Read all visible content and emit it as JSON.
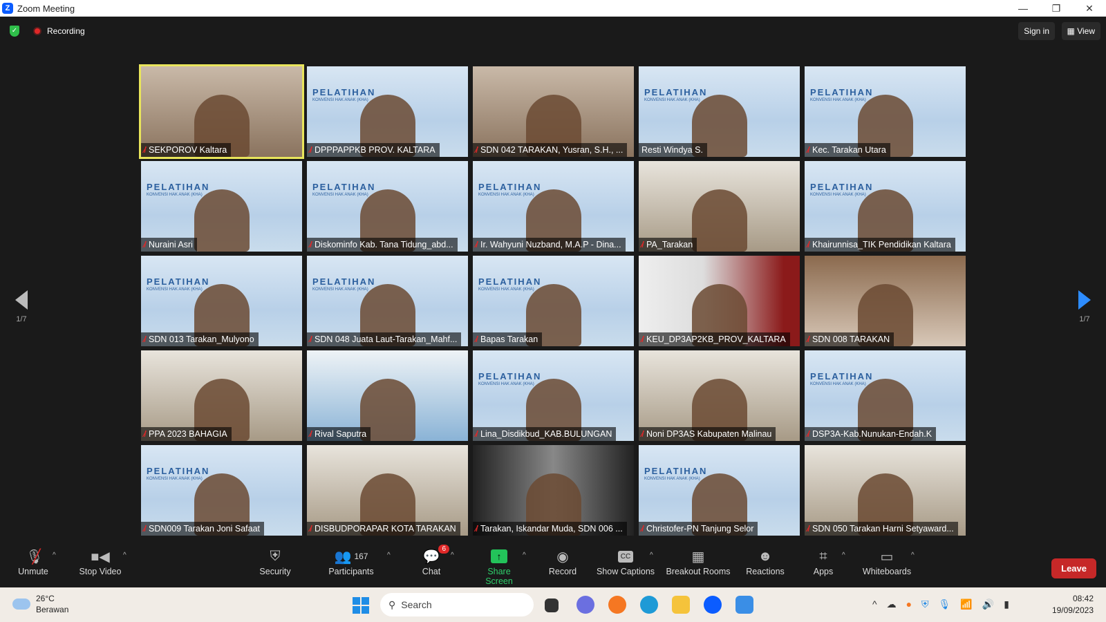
{
  "window": {
    "title": "Zoom Meeting",
    "controls": [
      "—",
      "❐",
      "✕"
    ]
  },
  "topbar": {
    "recording_label": "Recording",
    "sign_in": "Sign in",
    "view": "View"
  },
  "pagination": {
    "left": "1/7",
    "right": "1/7"
  },
  "tiles": [
    {
      "name": "SEKPOROV Kaltara",
      "bg": "office",
      "active": true,
      "muted": true
    },
    {
      "name": "DPPPAPPKB PROV. KALTARA",
      "bg": "slide",
      "muted": true
    },
    {
      "name": "SDN 042 TARAKAN, Yusran, S.H., ...",
      "bg": "office",
      "muted": true
    },
    {
      "name": "Resti Windya S.",
      "bg": "slide",
      "muted": false
    },
    {
      "name": "Kec. Tarakan Utara",
      "bg": "slide",
      "muted": true
    },
    {
      "name": "Nuraini Asri",
      "bg": "slide",
      "muted": true
    },
    {
      "name": "Diskominfo Kab. Tana Tidung_abd...",
      "bg": "slide",
      "muted": true
    },
    {
      "name": "Ir. Wahyuni Nuzband, M.A.P - Dina...",
      "bg": "slide",
      "muted": true
    },
    {
      "name": "PA_Tarakan",
      "bg": "room",
      "muted": true
    },
    {
      "name": "Khairunnisa_TIK Pendidikan Kaltara",
      "bg": "slide",
      "muted": true
    },
    {
      "name": "SDN 013 Tarakan_Mulyono",
      "bg": "slide",
      "muted": true
    },
    {
      "name": "SDN 048 Juata Laut-Tarakan_Mahf...",
      "bg": "slide",
      "muted": true
    },
    {
      "name": "Bapas Tarakan",
      "bg": "slide",
      "muted": true
    },
    {
      "name": "KEU_DP3AP2KB_PROV_KALTARA",
      "bg": "sahabat",
      "muted": true
    },
    {
      "name": "SDN 008 TARAKAN",
      "bg": "curtain",
      "muted": true
    },
    {
      "name": "PPA 2023 BAHAGIA",
      "bg": "room",
      "muted": true
    },
    {
      "name": "Rival Saputra",
      "bg": "blue",
      "muted": true
    },
    {
      "name": "Lina_Disdikbud_KAB.BULUNGAN",
      "bg": "slide",
      "muted": true
    },
    {
      "name": "Noni DP3AS Kabupaten Malinau",
      "bg": "room",
      "muted": true
    },
    {
      "name": "DSP3A-Kab.Nunukan-Endah.K",
      "bg": "slide",
      "muted": true
    },
    {
      "name": "SDN009 Tarakan Joni Safaat",
      "bg": "slide",
      "muted": true
    },
    {
      "name": "DISBUDPORAPAR KOTA TARAKAN",
      "bg": "room",
      "muted": true
    },
    {
      "name": "Tarakan, Iskandar Muda, SDN 006 ...",
      "bg": "dark",
      "muted": true
    },
    {
      "name": "Christofer-PN Tanjung Selor",
      "bg": "slide",
      "muted": true
    },
    {
      "name": "SDN 050 Tarakan Harni Setyaward...",
      "bg": "room",
      "muted": true
    }
  ],
  "slide": {
    "title": "PELATIHAN",
    "subtitle": "KONVENSI HAK ANAK (KHA)"
  },
  "toolbar": {
    "unmute": "Unmute",
    "stop_video": "Stop Video",
    "security": "Security",
    "participants": "Participants",
    "participants_count": "167",
    "chat": "Chat",
    "chat_badge": "6",
    "share_screen": "Share Screen",
    "record": "Record",
    "show_captions": "Show Captions",
    "captions_icon": "CC",
    "breakout_rooms": "Breakout Rooms",
    "reactions": "Reactions",
    "apps": "Apps",
    "whiteboards": "Whiteboards",
    "leave": "Leave"
  },
  "taskbar": {
    "temp": "26°C",
    "weather": "Berawan",
    "search_placeholder": "Search",
    "time": "08:42",
    "date": "19/09/2023"
  },
  "colors": {
    "share_green": "#23c35a",
    "leave_red": "#c62828",
    "active_speaker": "#e9e55b",
    "zoom_blue": "#0b5cff"
  }
}
